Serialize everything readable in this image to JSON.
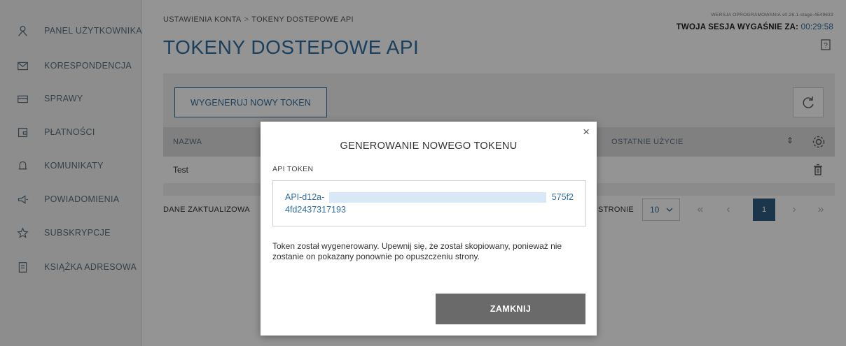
{
  "sidebar": {
    "items": [
      {
        "label": "PANEL UŻYTKOWNIKA",
        "icon": "user-icon"
      },
      {
        "label": "KORESPONDENCJA",
        "icon": "mail-icon"
      },
      {
        "label": "SPRAWY",
        "icon": "folder-icon"
      },
      {
        "label": "PŁATNOŚCI",
        "icon": "payment-icon"
      },
      {
        "label": "KOMUNIKATY",
        "icon": "bell-icon"
      },
      {
        "label": "POWIADOMIENIA",
        "icon": "megaphone-icon"
      },
      {
        "label": "SUBSKRYPCJE",
        "icon": "star-icon"
      },
      {
        "label": "KSIĄŻKA ADRESOWA",
        "icon": "address-book-icon"
      }
    ]
  },
  "header": {
    "breadcrumb": [
      "USTAWIENIA KONTA",
      "TOKENY DOSTEPOWE API"
    ],
    "breadcrumb_sep": ">",
    "title": "TOKENY DOSTEPOWE API",
    "version": "WERSJA OPROGRAMOWANIA v0.26.1-stage-4549633",
    "session_label": "TWOJA SESJA WYGAŚNIE ZA:",
    "session_timer": "00:29:58"
  },
  "toolbar": {
    "generate_label": "WYGENERUJ NOWY TOKEN"
  },
  "table": {
    "columns": [
      "NAZWA",
      "OSTATNIE UŻYCIE"
    ],
    "sort_glyph": "⇕",
    "rows": [
      {
        "name": "Test"
      }
    ]
  },
  "footer": {
    "updated_label": "DANE ZAKTUALIZOWA",
    "per_page_label": "STRONIE",
    "per_page_value": "10",
    "pagination": {
      "first": "«",
      "prev": "‹",
      "current": "1",
      "next": "›",
      "last": "»"
    }
  },
  "modal": {
    "title": "GENEROWANIE NOWEGO TOKENU",
    "close_glyph": "×",
    "api_label": "API TOKEN",
    "token_start": "API-d12a-",
    "token_end": "575f2",
    "token_line2": "4fd2437317193",
    "message": "Token został wygenerowany. Upewnij się, że został skopiowany, ponieważ nie zostanie on pokazany ponownie po opuszczeniu strony.",
    "close_button": "ZAMKNIJ"
  },
  "colors": {
    "accent": "#2f6ea0",
    "overlay": "rgba(0,0,0,0.42)",
    "close_button_bg": "#6a6a6a",
    "active_page_bg": "#2f5e80"
  }
}
